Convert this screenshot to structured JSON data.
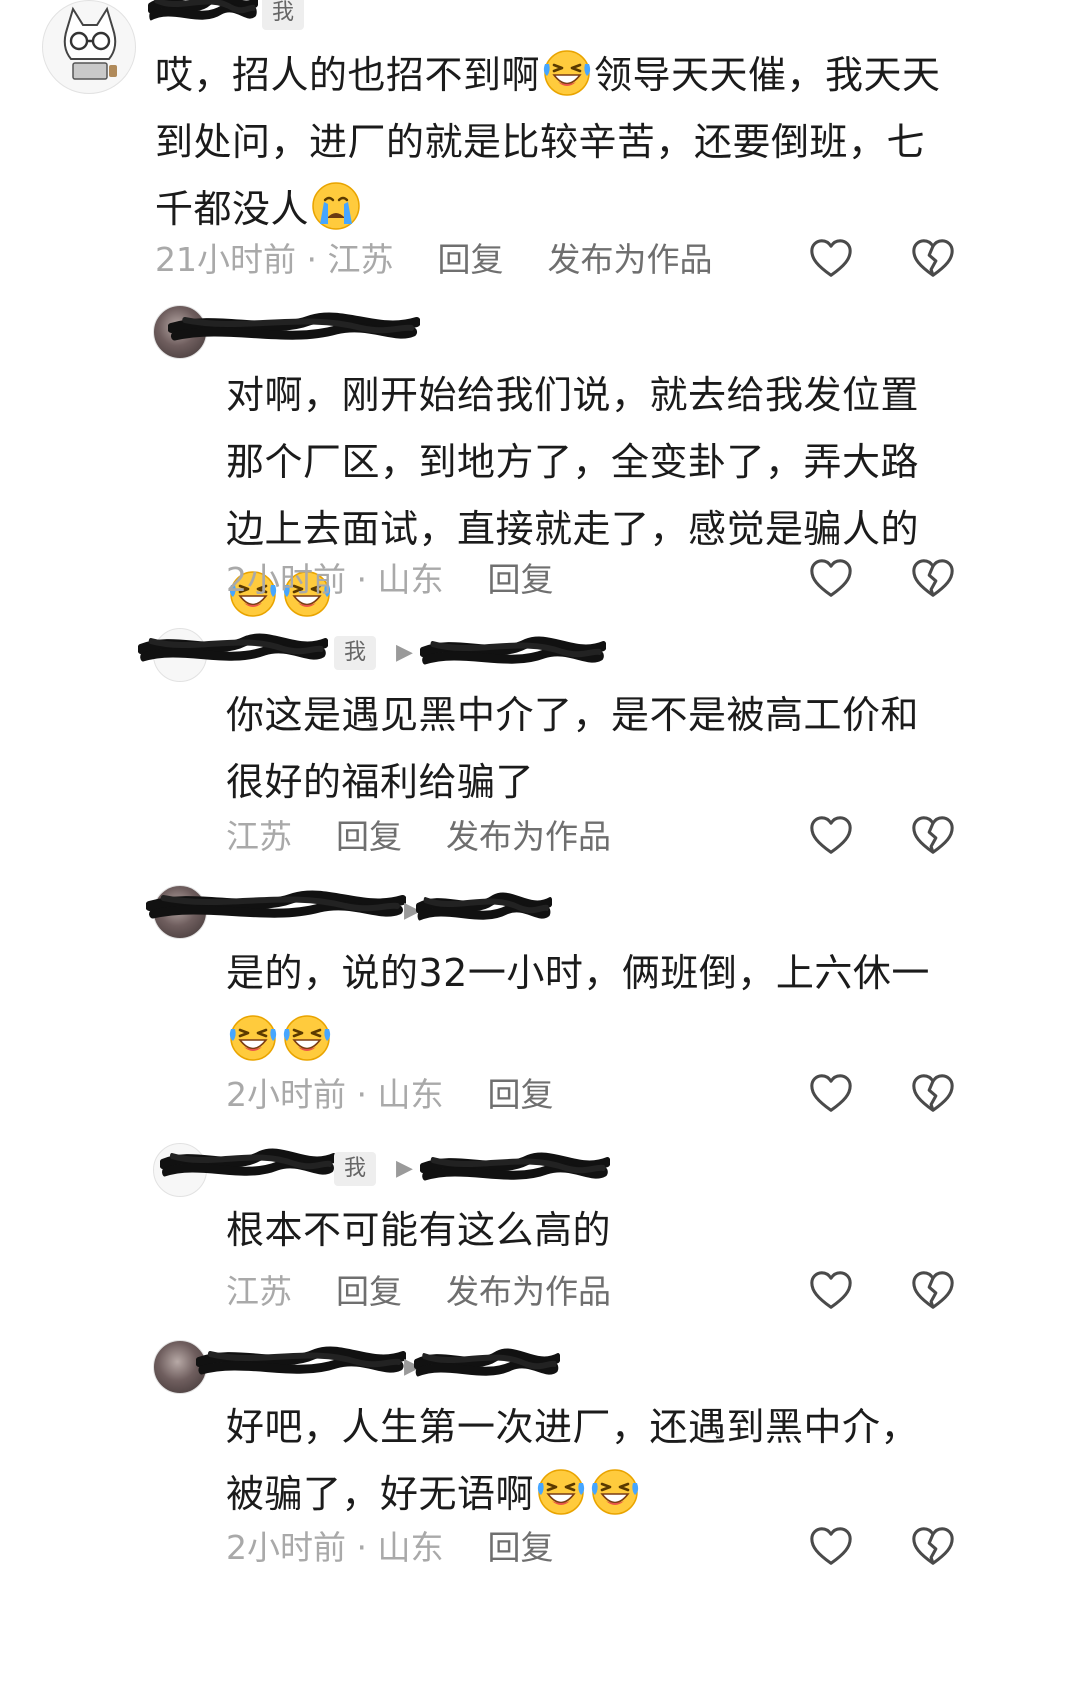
{
  "comments": [
    {
      "me_badge": "我",
      "text": "哎，招人的也招不到啊",
      "text_b": "领导天天催，我天天到处问，进厂的就是比较辛苦，还要倒班，七千都没人",
      "time_location": "21小时前 · 江苏",
      "reply": "回复",
      "publish": "发布为作品"
    },
    {
      "text": "对啊，刚开始给我们说，就去给我发位置那个厂区，到地方了，全变卦了，弄大路边上去面试，直接就走了，感觉是骗人的",
      "time_location": "2小时前 · 山东",
      "reply": "回复"
    },
    {
      "me_badge": "我",
      "text": "你这是遇见黑中介了，是不是被高工价和很好的福利给骗了",
      "time_location": "江苏",
      "reply": "回复",
      "publish": "发布为作品"
    },
    {
      "text": "是的，说的32一小时，俩班倒，上六休一",
      "time_location": "2小时前 · 山东",
      "reply": "回复"
    },
    {
      "me_badge": "我",
      "text": "根本不可能有这么高的",
      "time_location": "江苏",
      "reply": "回复",
      "publish": "发布为作品"
    },
    {
      "text": "好吧，人生第一次进厂，还遇到黑中介，被骗了，好无语啊",
      "time_location": "2小时前 · 山东",
      "reply": "回复"
    }
  ],
  "icons": {
    "like": "heart-outline-icon",
    "dislike": "broken-heart-icon",
    "crying_emoji": "crying-face-emoji",
    "laughing_crying_emoji": "laugh-cry-emoji",
    "reply_arrow": "play-triangle-icon"
  },
  "colors": {
    "text": "#1b1b1b",
    "meta": "#a9a9a9",
    "action": "#6f6f6f",
    "badge_bg": "#eeeeee"
  }
}
